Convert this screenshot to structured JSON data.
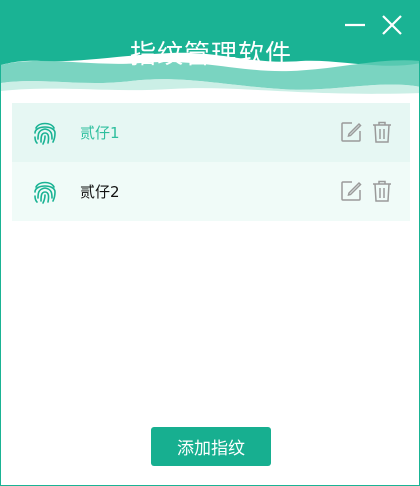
{
  "window": {
    "title": "指纹管理软件"
  },
  "fingerprints": [
    {
      "name": "贰仔1",
      "selected": true
    },
    {
      "name": "贰仔2",
      "selected": false
    }
  ],
  "actions": {
    "add_label": "添加指纹"
  },
  "icons": {
    "minimize": "minimize-icon",
    "close": "close-icon",
    "fingerprint": "fingerprint-icon",
    "edit": "edit-icon",
    "delete": "trash-icon"
  },
  "colors": {
    "brand": "#17af90",
    "selected_text": "#2ebf9e",
    "list_bg": "#f0fbf8",
    "icon_gray": "#9a9a9a"
  }
}
